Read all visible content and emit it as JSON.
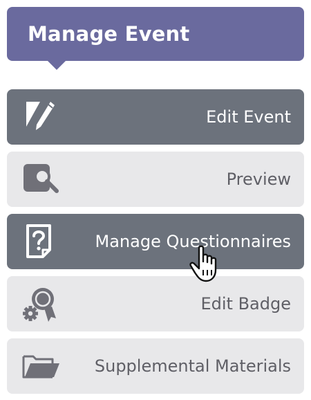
{
  "header": {
    "title": "Manage Event"
  },
  "menu": {
    "items": [
      {
        "label": "Edit Event",
        "icon": "edit-pen-icon",
        "style": "dark"
      },
      {
        "label": "Preview",
        "icon": "preview-magnifier-icon",
        "style": "light"
      },
      {
        "label": "Manage Questionnaires",
        "icon": "questionnaire-icon",
        "style": "dark"
      },
      {
        "label": "Edit Badge",
        "icon": "badge-gear-icon",
        "style": "light"
      },
      {
        "label": "Supplemental Materials",
        "icon": "folder-icon",
        "style": "light"
      }
    ]
  },
  "colors": {
    "header_bg": "#6a6a9e",
    "dark_item_bg": "#6c727c",
    "light_item_bg": "#e8e8ea",
    "light_item_text": "#5f5f66"
  }
}
